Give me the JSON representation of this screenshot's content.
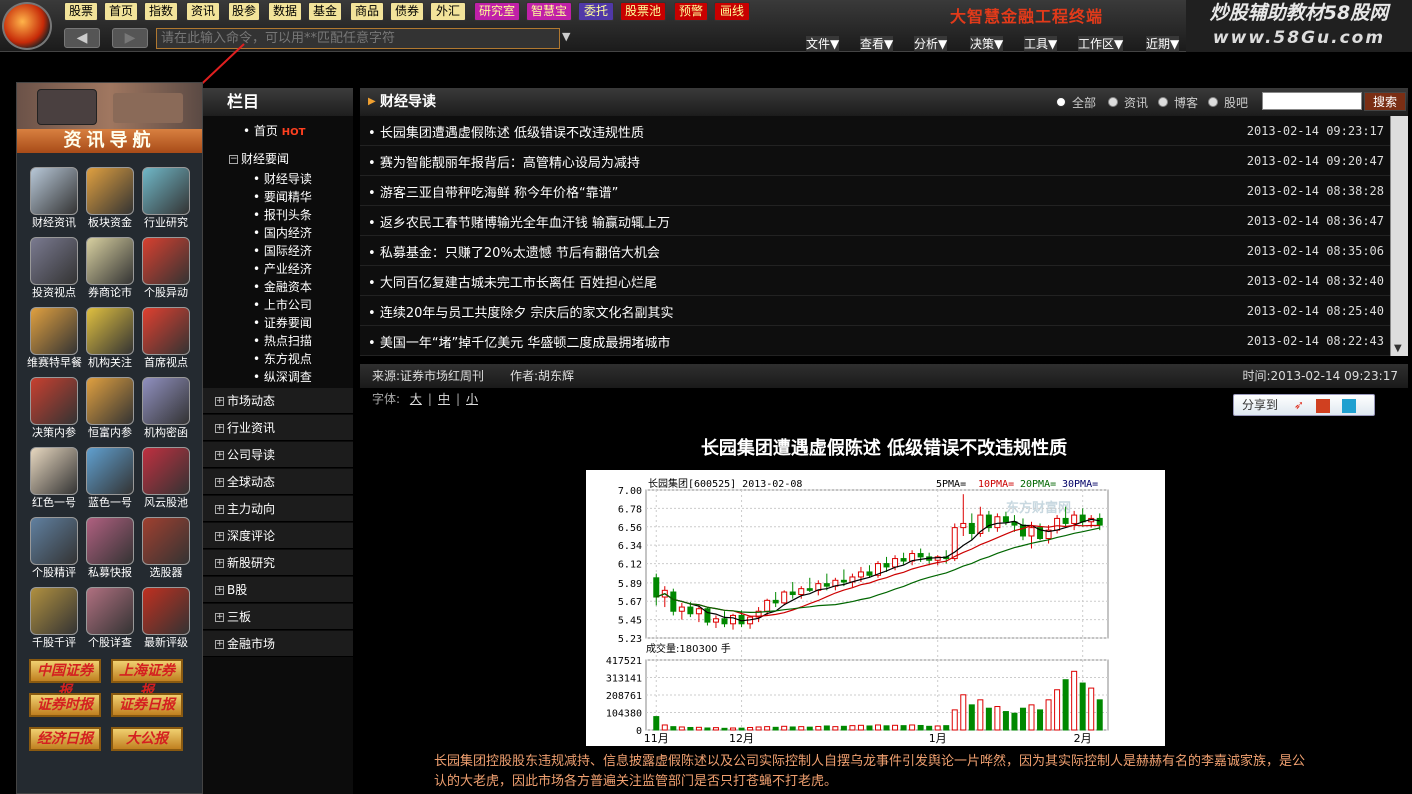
{
  "topbar": {
    "buttons": [
      "股票",
      "首页",
      "指数",
      "资讯",
      "股参",
      "数据",
      "基金",
      "商品",
      "债券",
      "外汇",
      "研究室",
      "智慧宝",
      "委托",
      "股票池",
      "预警",
      "画线"
    ],
    "cmd_placeholder": "请在此输入命令，可以用**匹配任意字符",
    "brand": "大智慧金融工程终端",
    "menus": [
      "文件▼",
      "查看▼",
      "分析▼",
      "决策▼",
      "工具▼",
      "工作区▼",
      "近期▼"
    ],
    "slogan_line1": "炒股辅助教材58股网",
    "slogan_line2": "www.58Gu.com"
  },
  "leftnav": {
    "title": "资讯导航",
    "icons": [
      "财经资讯",
      "板块资金",
      "行业研究",
      "投资视点",
      "券商论市",
      "个股异动",
      "维赛特早餐",
      "机构关注",
      "首席视点",
      "决策内参",
      "恒富内参",
      "机构密函",
      "红色一号",
      "蓝色一号",
      "风云股池",
      "个股精评",
      "私募快报",
      "选股器",
      "千股千评",
      "个股详查",
      "最新评级"
    ],
    "red_buttons": [
      "中国证券报",
      "上海证券报",
      "证券时报",
      "证券日报",
      "经济日报",
      "大公报"
    ]
  },
  "colnav": {
    "header": "栏目",
    "home": "首页",
    "hot": "HOT",
    "open_section": "财经要闻",
    "subitems": [
      "财经导读",
      "要闻精华",
      "报刊头条",
      "国内经济",
      "国际经济",
      "产业经济",
      "金融资本",
      "上市公司",
      "证券要闻",
      "热点扫描",
      "东方视点",
      "纵深调查"
    ],
    "sections": [
      "市场动态",
      "行业资讯",
      "公司导读",
      "全球动态",
      "主力动向",
      "深度评论",
      "新股研究",
      "B股",
      "三板",
      "金融市场"
    ]
  },
  "main": {
    "header": "财经导读",
    "filters": [
      "全部",
      "资讯",
      "博客",
      "股吧"
    ],
    "search_label": "搜索",
    "news": [
      {
        "title": "长园集团遭遇虚假陈述 低级错误不改违规性质",
        "time": "2013-02-14 09:23:17"
      },
      {
        "title": "赛为智能靓丽年报背后：高管精心设局为减持",
        "time": "2013-02-14 09:20:47"
      },
      {
        "title": "游客三亚自带秤吃海鲜 称今年价格“靠谱”",
        "time": "2013-02-14 08:38:28"
      },
      {
        "title": "返乡农民工春节赌博输光全年血汗钱 输赢动辄上万",
        "time": "2013-02-14 08:36:47"
      },
      {
        "title": "私募基金：只赚了20%太遗憾 节后有翻倍大机会",
        "time": "2013-02-14 08:35:06"
      },
      {
        "title": "大同百亿复建古城未完工市长离任 百姓担心烂尾",
        "time": "2013-02-14 08:32:40"
      },
      {
        "title": "连续20年与员工共度除夕 宗庆后的家文化名副其实",
        "time": "2013-02-14 08:25:40"
      },
      {
        "title": "美国一年“堵”掉千亿美元 华盛顿二度成最拥堵城市",
        "time": "2013-02-14 08:22:43"
      }
    ],
    "source": "来源:证券市场红周刊",
    "author": "作者:胡东辉",
    "pub_time": "时间:2013-02-14 09:23:17",
    "font_label": "字体:",
    "font_sizes": [
      "大",
      "中",
      "小"
    ],
    "share_label": "分享到",
    "article_title": "长园集团遭遇虚假陈述 低级错误不改违规性质",
    "paragraph": "长园集团控股股东违规减持、信息披露虚假陈述以及公司实际控制人自摆乌龙事件引发舆论一片哗然，因为其实际控制人是赫赫有名的李嘉诚家族，是公认的大老虎，因此市场各方普遍关注监管部门是否只打苍蝇不打老虎。"
  },
  "chart_data": {
    "type": "candlestick",
    "title": "长园集团[600525] 2013-02-08",
    "legend": [
      "5PMA=",
      "10PMA=",
      "20PMA=",
      "30PMA="
    ],
    "watermark": "东方财富网",
    "price_ticks": [
      "7.00",
      "6.78",
      "6.56",
      "6.34",
      "6.12",
      "5.89",
      "5.67",
      "5.45",
      "5.23"
    ],
    "ylim": [
      5.23,
      7.0
    ],
    "volume_label": "成交量:180300 手",
    "volume_ticks": [
      "417521",
      "313141",
      "208761",
      "104380",
      "0"
    ],
    "x_ticks": [
      "11月",
      "12月",
      "1月",
      "2月"
    ],
    "candles": [
      [
        5.95,
        6.0,
        5.62,
        5.72
      ],
      [
        5.72,
        5.85,
        5.6,
        5.8
      ],
      [
        5.78,
        5.82,
        5.5,
        5.55
      ],
      [
        5.55,
        5.65,
        5.45,
        5.6
      ],
      [
        5.6,
        5.66,
        5.48,
        5.52
      ],
      [
        5.52,
        5.62,
        5.42,
        5.58
      ],
      [
        5.58,
        5.6,
        5.38,
        5.42
      ],
      [
        5.42,
        5.5,
        5.35,
        5.46
      ],
      [
        5.46,
        5.55,
        5.36,
        5.4
      ],
      [
        5.4,
        5.52,
        5.33,
        5.5
      ],
      [
        5.5,
        5.56,
        5.36,
        5.4
      ],
      [
        5.4,
        5.5,
        5.34,
        5.48
      ],
      [
        5.48,
        5.6,
        5.42,
        5.55
      ],
      [
        5.55,
        5.7,
        5.5,
        5.68
      ],
      [
        5.68,
        5.78,
        5.6,
        5.65
      ],
      [
        5.65,
        5.8,
        5.62,
        5.78
      ],
      [
        5.78,
        5.9,
        5.7,
        5.75
      ],
      [
        5.75,
        5.85,
        5.7,
        5.82
      ],
      [
        5.82,
        5.95,
        5.78,
        5.8
      ],
      [
        5.8,
        5.92,
        5.74,
        5.88
      ],
      [
        5.88,
        6.0,
        5.8,
        5.85
      ],
      [
        5.85,
        5.95,
        5.8,
        5.92
      ],
      [
        5.92,
        6.05,
        5.85,
        5.9
      ],
      [
        5.9,
        6.0,
        5.84,
        5.96
      ],
      [
        5.96,
        6.08,
        5.9,
        6.02
      ],
      [
        6.02,
        6.1,
        5.95,
        5.98
      ],
      [
        5.98,
        6.15,
        5.95,
        6.12
      ],
      [
        6.12,
        6.2,
        6.02,
        6.08
      ],
      [
        6.08,
        6.22,
        6.04,
        6.18
      ],
      [
        6.18,
        6.25,
        6.1,
        6.15
      ],
      [
        6.15,
        6.28,
        6.1,
        6.24
      ],
      [
        6.24,
        6.3,
        6.14,
        6.2
      ],
      [
        6.2,
        6.25,
        6.1,
        6.16
      ],
      [
        6.16,
        6.22,
        6.1,
        6.2
      ],
      [
        6.2,
        6.28,
        6.12,
        6.18
      ],
      [
        6.18,
        6.6,
        6.15,
        6.55
      ],
      [
        6.55,
        6.95,
        6.45,
        6.6
      ],
      [
        6.6,
        6.72,
        6.4,
        6.48
      ],
      [
        6.48,
        6.8,
        6.44,
        6.7
      ],
      [
        6.7,
        6.75,
        6.5,
        6.55
      ],
      [
        6.55,
        6.72,
        6.5,
        6.68
      ],
      [
        6.68,
        6.74,
        6.58,
        6.62
      ],
      [
        6.62,
        6.7,
        6.5,
        6.58
      ],
      [
        6.58,
        6.66,
        6.4,
        6.45
      ],
      [
        6.45,
        6.62,
        6.3,
        6.55
      ],
      [
        6.55,
        6.6,
        6.4,
        6.42
      ],
      [
        6.42,
        6.58,
        6.36,
        6.52
      ],
      [
        6.52,
        6.7,
        6.48,
        6.66
      ],
      [
        6.66,
        6.8,
        6.55,
        6.6
      ],
      [
        6.6,
        6.75,
        6.52,
        6.7
      ],
      [
        6.7,
        6.78,
        6.56,
        6.62
      ],
      [
        6.62,
        6.7,
        6.55,
        6.66
      ],
      [
        6.66,
        6.72,
        6.52,
        6.58
      ]
    ],
    "volumes": [
      80000,
      30000,
      20000,
      18000,
      15000,
      16000,
      12000,
      14000,
      10000,
      12000,
      11000,
      15000,
      18000,
      20000,
      16000,
      22000,
      18000,
      20000,
      17000,
      21000,
      24000,
      20000,
      22000,
      26000,
      28000,
      24000,
      30000,
      25000,
      28000,
      26000,
      30000,
      27000,
      22000,
      24000,
      26000,
      120000,
      210000,
      150000,
      180000,
      130000,
      140000,
      110000,
      100000,
      130000,
      150000,
      120000,
      180000,
      240000,
      300000,
      350000,
      280000,
      250000,
      180000
    ]
  }
}
